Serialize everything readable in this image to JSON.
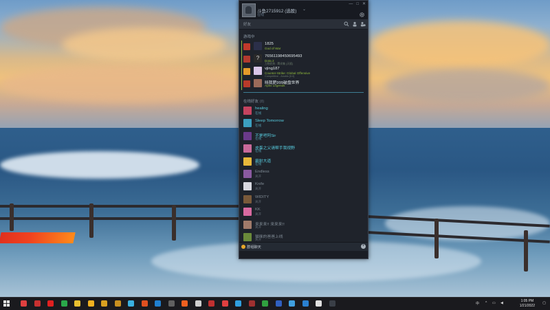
{
  "window": {
    "username": "斗鱼2715912",
    "username_suffix": "(选股)",
    "status": "在线",
    "search_label": "好友",
    "buttons": {
      "minimize": "—",
      "maximize": "□",
      "close": "✕"
    }
  },
  "ingame_section": {
    "title": "游戏中"
  },
  "ingame": [
    {
      "name": "1825",
      "game": "God of War",
      "extra": "",
      "avatar": "#2b2f49",
      "game_icon": "#c0392b"
    },
    {
      "name": "76561198450695493",
      "game": "Dota 2",
      "extra": "万物炽热 · 羁绊集 (天赋)",
      "avatar": "#2a2a2a",
      "game_icon": "#b23a2f",
      "avatar_glyph": "?"
    },
    {
      "name": "vjing187",
      "game": "Counter-Strike: Global Offensive",
      "extra": "Competitive - Anubis [0:0]",
      "avatar": "#d9c6e8",
      "game_icon": "#e59b2a"
    },
    {
      "name": "晓我肥999破盘世界",
      "game": "Apex Legends",
      "extra": "",
      "avatar": "#9a6a5a",
      "game_icon": "#b83a2a"
    }
  ],
  "online_section": {
    "title": "在线好友",
    "count": "(8)"
  },
  "friends": [
    {
      "name": "healing",
      "status": "在线",
      "state": "online",
      "avatar": "#c4435f"
    },
    {
      "name": "Sleep Tomorrow",
      "status": "在线",
      "state": "online",
      "avatar": "#3c9fbf"
    },
    {
      "name": "不是吧阿Sir",
      "status": "在线",
      "state": "online",
      "avatar": "#6a3a8a"
    },
    {
      "name": "皮蛋之父请帮手我视野",
      "status": "在线",
      "state": "online",
      "avatar": "#c86a9a"
    },
    {
      "name": "霸耐大道",
      "status": "在线",
      "state": "online",
      "avatar": "#e8b83a"
    },
    {
      "name": "Endless",
      "status": "离开",
      "state": "offline",
      "avatar": "#8a5aa0"
    },
    {
      "name": "Knife",
      "status": "离开",
      "state": "offline",
      "avatar": "#d8d8e0"
    },
    {
      "name": "WIDITY",
      "status": "离开",
      "state": "offline",
      "avatar": "#7a5a3a"
    },
    {
      "name": "KK",
      "status": "离开",
      "state": "offline",
      "avatar": "#d86aa0"
    },
    {
      "name": "来来来!! 来来来!!",
      "status": "离开",
      "state": "offline",
      "avatar": "#a07a6a"
    },
    {
      "name": "猫咪的爸爸上线",
      "status": "离开",
      "state": "offline",
      "avatar": "#6a8a3a"
    }
  ],
  "chatbar": {
    "label": "群组聊天",
    "plus": "+"
  },
  "taskbar": {
    "lang": "中",
    "time": "1:05 PM",
    "date": "1/21/2022",
    "icons": [
      "#e04040",
      "#c83030",
      "#e02020",
      "#2aa84a",
      "#e8c030",
      "#f0b020",
      "#d8a020",
      "#c89020",
      "#3ab0e0",
      "#e05020",
      "#2080d0",
      "#606060",
      "#f06020",
      "#d0d0d0",
      "#c03030",
      "#e04040",
      "#30a0e0",
      "#a03030",
      "#30a040",
      "#3060c0",
      "#40a0e0",
      "#2a80d0",
      "#e0e0e0",
      "#3a3f47"
    ]
  },
  "colors": {
    "accent": "#57cbde",
    "ingame_green": "#90ba3c",
    "window_bg": "#1f232b"
  }
}
